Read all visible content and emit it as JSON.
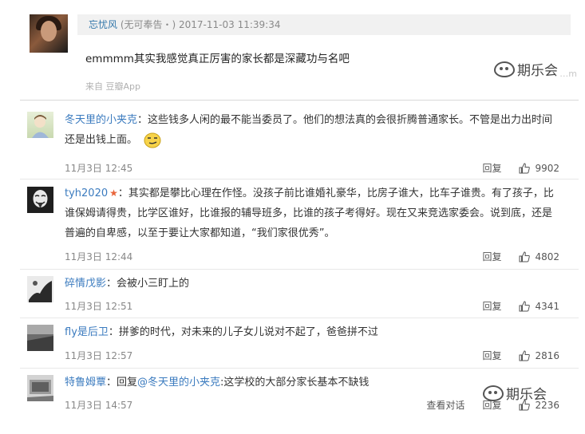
{
  "top_card": {
    "user": "忘忧风",
    "meta": "(无可奉告・)   2017-11-03 11:39:34",
    "body": "emmmm其实我感觉真正厉害的家长都是深藏功与名吧",
    "source": "来自 豆瓣App"
  },
  "watermark": {
    "text": "期乐会",
    "faint": "…m"
  },
  "comments": [
    {
      "user": "冬天里的小夹克",
      "text_line1": "：这些钱多人闲的最不能当委员了。他们的想法真的会很折腾普通家长。不管是出力出时间",
      "text_line2": "还是出钱上面。",
      "time": "11月3日 12:45",
      "reply_label": "回复",
      "likes": "9902",
      "emoji": "smirk-emoji"
    },
    {
      "user": "tyh2020",
      "text_line1": "：其实都是攀比心理在作怪。没孩子前比谁婚礼豪华，比房子谁大，比车子谁贵。有了孩子，比",
      "text_line2": "谁保姆请得贵，比学区谁好，比谁报的辅导班多，比谁的孩子考得好。现在又来竞选家委会。说到底，还是",
      "text_line3": "普遍的自卑感，以至于要让大家都知道，“我们家很优秀”。",
      "time": "11月3日 12:44",
      "reply_label": "回复",
      "likes": "4802",
      "badge": "star-icon"
    },
    {
      "user": "碎情戊影",
      "text_line1": "：会被小三盯上的",
      "time": "11月3日 12:51",
      "reply_label": "回复",
      "likes": "4341"
    },
    {
      "user": "fly是后卫",
      "text_line1": "：拼爹的时代，对未来的儿子女儿说对不起了，爸爸拼不过",
      "time": "11月3日 12:57",
      "reply_label": "回复",
      "likes": "2816"
    },
    {
      "user": "特鲁姆覃",
      "text_prefix": "：回复",
      "mention": "@冬天里的小夹克",
      "text_line1": ":这学校的大部分家长基本不缺钱",
      "time": "11月3日 14:57",
      "view_conv_label": "查看对话",
      "reply_label": "回复",
      "likes": "2236"
    }
  ],
  "colors": {
    "link_blue": "#3b7bbf",
    "douban_blue": "#3377aa",
    "meta_gray": "#888888",
    "badge_orange": "#e8643a"
  }
}
